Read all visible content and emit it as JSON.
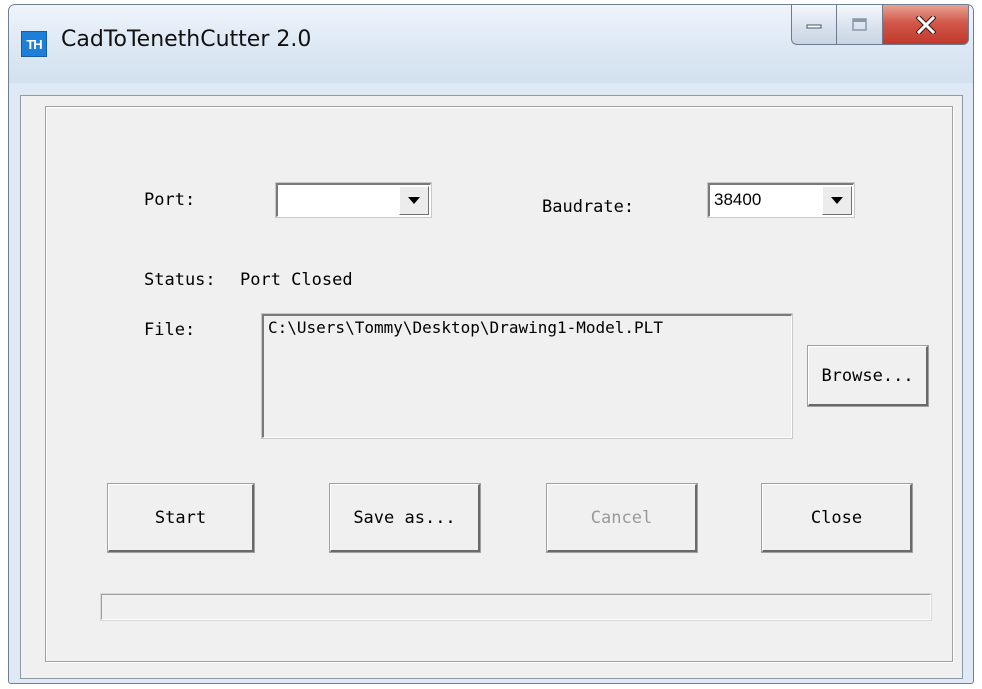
{
  "window": {
    "title": "CadToTenethCutter 2.0",
    "icon_text": "TH",
    "icon_name": "app-logo-icon",
    "accent_color": "#1e7fd8",
    "close_button_color": "#c0392b"
  },
  "form": {
    "port_label": "Port:",
    "port_value": "",
    "baudrate_label": "Baudrate:",
    "baudrate_value": "38400",
    "status_label": "Status:",
    "status_value": "Port Closed",
    "file_label": "File:",
    "file_path": "C:\\Users\\Tommy\\Desktop\\Drawing1-Model.PLT",
    "browse_label": "Browse..."
  },
  "buttons": {
    "start": "Start",
    "save_as": "Save as...",
    "cancel": "Cancel",
    "close": "Close"
  },
  "progress": {
    "value": 0
  }
}
